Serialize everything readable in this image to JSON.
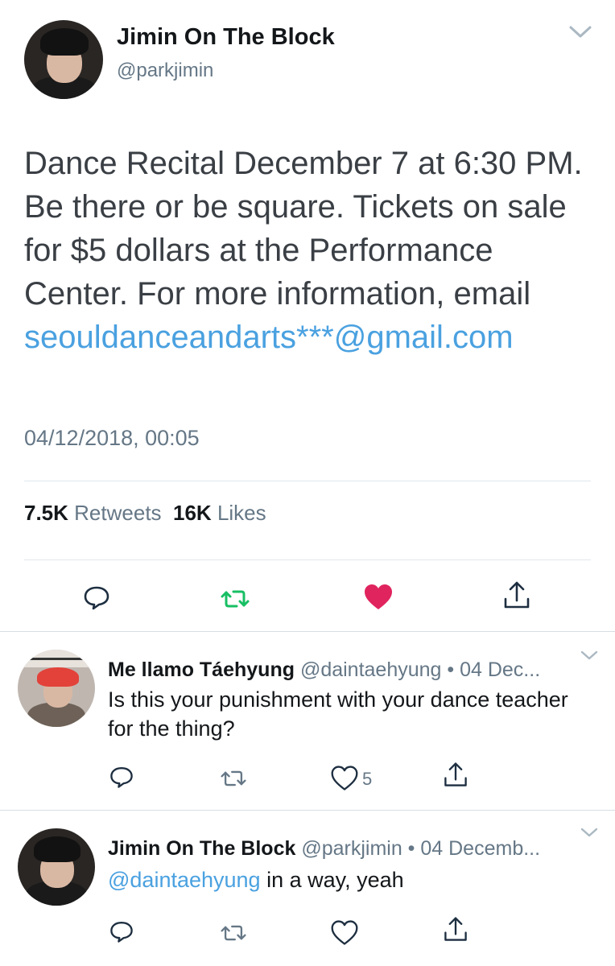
{
  "main_tweet": {
    "author_name": "Jimin On The Block",
    "author_handle": "@parkjimin",
    "text": "Dance Recital December 7 at 6:30 PM. Be there or be square. Tickets on sale for $5 dollars at the Performance Center. For more information, email ",
    "link": "seouldanceandarts***@gmail.com",
    "timestamp": "04/12/2018, 00:05",
    "retweets_count": "7.5K",
    "retweets_label": "Retweets",
    "likes_count": "16K",
    "likes_label": "Likes",
    "liked": true,
    "colors": {
      "link": "#4aa1e0",
      "retweet_active": "#17bf63",
      "like_active": "#e0245e"
    }
  },
  "replies": [
    {
      "author_name": "Me llamo Táehyung",
      "meta": "@daintaehyung • 04 Dec...",
      "text": "Is this your punishment with your dance teacher for the thing?",
      "like_count": "5"
    },
    {
      "author_name": "Jimin On The Block",
      "meta": "@parkjimin • 04 Decemb...",
      "mention": "@daintaehyung",
      "text": " in a way, yeah"
    }
  ],
  "icons": [
    "reply-icon",
    "retweet-icon",
    "like-icon",
    "share-icon",
    "chevron-down-icon"
  ]
}
